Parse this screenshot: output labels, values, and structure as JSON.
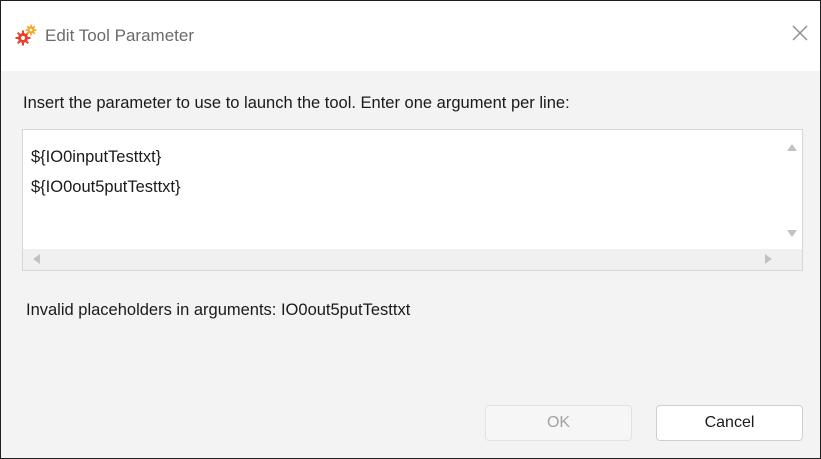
{
  "window": {
    "title": "Edit Tool Parameter",
    "icon": "gears-icon",
    "close_icon": "close-icon"
  },
  "instruction": "Insert the parameter to use to launch the tool. Enter one argument per line:",
  "arguments": {
    "lines": [
      "${IO0inputTesttxt}",
      "${IO0out5putTesttxt}"
    ]
  },
  "error": "Invalid placeholders in arguments: IO0out5putTesttxt",
  "buttons": {
    "ok": "OK",
    "ok_enabled": false,
    "cancel": "Cancel"
  },
  "colors": {
    "icon_primary": "#e8412a",
    "icon_secondary": "#f5a623"
  }
}
